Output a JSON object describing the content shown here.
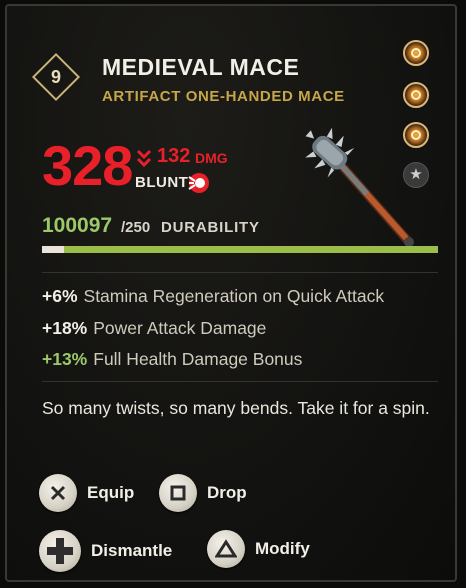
{
  "item": {
    "tier": "9",
    "name": "MEDIEVAL MACE",
    "subtitle": "ARTIFACT ONE-HANDED MACE",
    "mod_slots": [
      "filled",
      "filled",
      "filled",
      "star"
    ]
  },
  "stats": {
    "damage": "328",
    "damage_diff": "132",
    "damage_diff_unit": "DMG",
    "damage_type": "BLUNT"
  },
  "durability": {
    "current": "100097",
    "max": "/250",
    "label": "DURABILITY",
    "fill_fraction": 1.0
  },
  "perks": [
    {
      "value": "+6%",
      "text": "Stamina Regeneration on Quick Attack",
      "kind": "normal"
    },
    {
      "value": "+18%",
      "text": "Power Attack Damage",
      "kind": "normal"
    },
    {
      "value": "+13%",
      "text": "Full Health Damage Bonus",
      "kind": "bonus"
    }
  ],
  "description": "So many twists, so many bends. Take it for a spin.",
  "actions": {
    "equip": "Equip",
    "drop": "Drop",
    "dismantle": "Dismantle",
    "modify": "Modify"
  },
  "colors": {
    "damage": "#e8202a",
    "bonus": "#9bc96a",
    "rarity": "#c6a649"
  },
  "icons": {
    "equip": "cross-button-icon",
    "drop": "square-button-icon",
    "dismantle": "dpad-icon",
    "modify": "triangle-button-icon"
  }
}
